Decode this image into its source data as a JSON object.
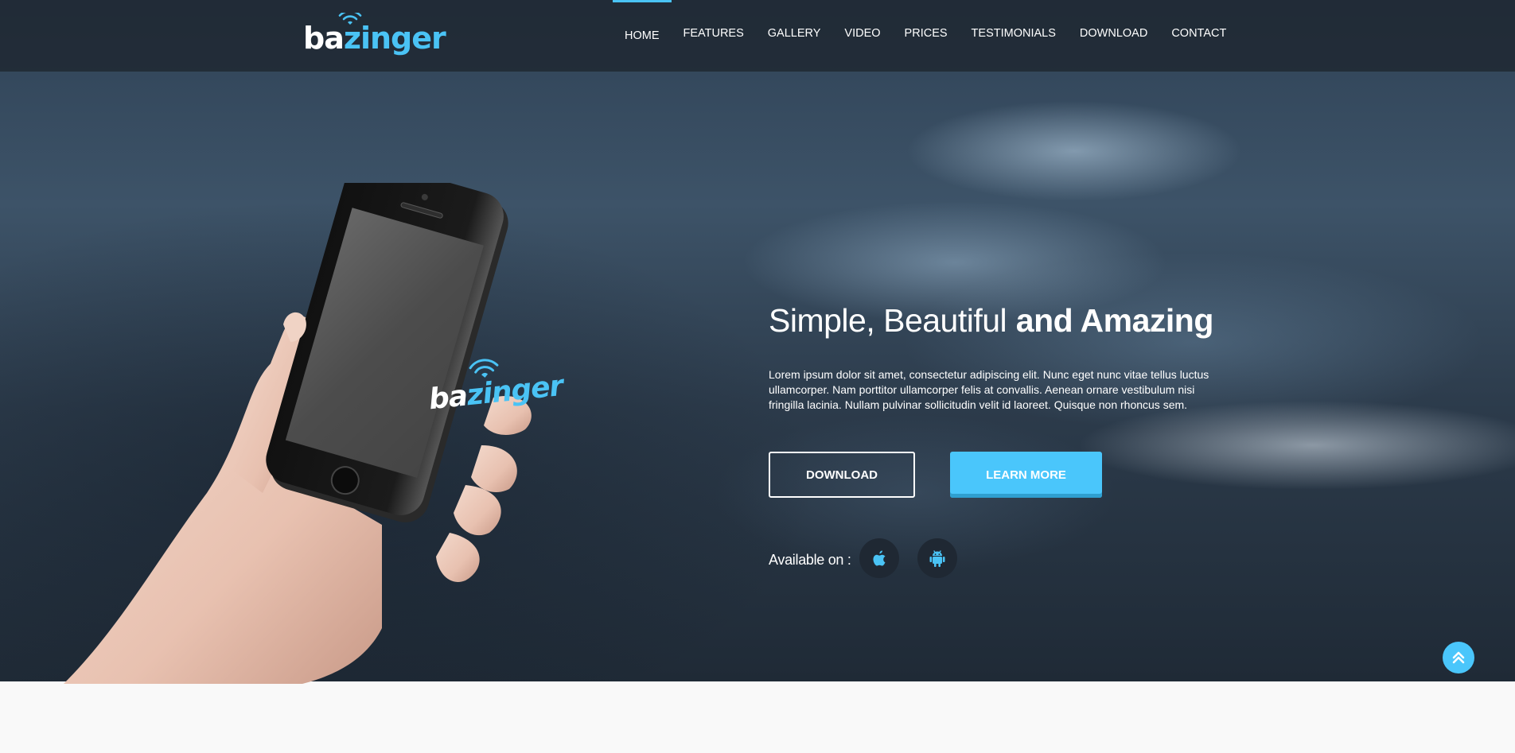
{
  "brand": {
    "prefix": "ba",
    "suffix": "zinger",
    "accent": "#4ac3f5"
  },
  "nav": {
    "items": [
      {
        "label": "HOME",
        "active": true
      },
      {
        "label": "FEATURES"
      },
      {
        "label": "GALLERY"
      },
      {
        "label": "VIDEO"
      },
      {
        "label": "PRICES"
      },
      {
        "label": "TESTIMONIALS"
      },
      {
        "label": "DOWNLOAD"
      },
      {
        "label": "CONTACT"
      }
    ]
  },
  "phone_screen": {
    "prefix": "ba",
    "suffix": "zinger"
  },
  "hero": {
    "headline_light": "Simple, Beautiful",
    "headline_bold": "and Amazing",
    "body": "Lorem ipsum dolor sit amet, consectetur adipiscing elit. Nunc eget nunc vitae tellus luctus ullamcorper. Nam porttitor ullamcorper felis at convallis. Aenean ornare vestibulum nisi fringilla lacinia. Nullam pulvinar sollicitudin velit id laoreet. Quisque non rhoncus sem.",
    "download_label": "DOWNLOAD",
    "learn_more_label": "LEARN MORE",
    "available_label": "Available on :",
    "stores": [
      {
        "icon": "apple-icon"
      },
      {
        "icon": "android-icon"
      }
    ]
  },
  "scroll_top": {
    "icon": "double-chevron-up-icon"
  }
}
